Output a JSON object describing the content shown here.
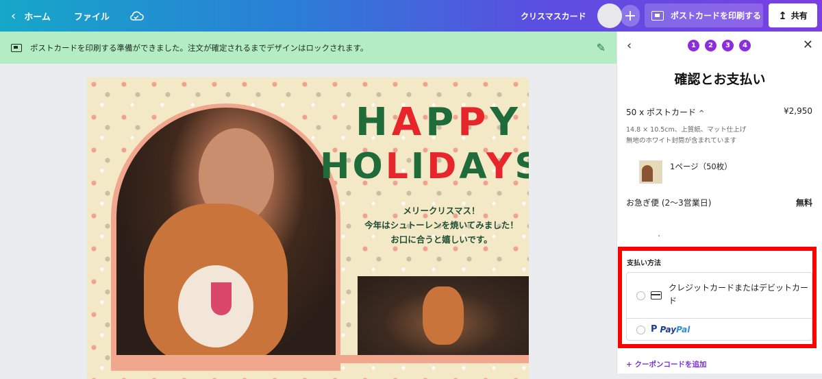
{
  "topbar": {
    "home_chevron": "‹",
    "home_label": "ホーム",
    "file_label": "ファイル",
    "cloud_icon": "cloud-sync-icon",
    "doc_title": "クリスマスカード",
    "plus_label": "+",
    "print_label": "ポストカードを印刷する",
    "share_label": "共有",
    "share_icon": "↥"
  },
  "notice": {
    "text": "ポストカードを印刷する準備ができました。注文が確定されるまでデザインはロックされます。",
    "edit_icon": "✎"
  },
  "card": {
    "happy": [
      "H",
      "A",
      "P",
      "P",
      "Y"
    ],
    "holidays": [
      "H",
      "O",
      "L",
      "I",
      "D",
      "A",
      "Y",
      "S"
    ],
    "greeting_1": "メリークリスマス！",
    "greeting_2": "今年はシュトーレンを焼いてみました！",
    "greeting_3": "お口に合うと嬉しいです。"
  },
  "panel": {
    "back": "‹",
    "steps": [
      "1",
      "2",
      "3",
      "4"
    ],
    "close": "✕",
    "title": "確認とお支払い",
    "item_label": "50 x ポストカード",
    "item_caret": "^",
    "item_price": "¥2,950",
    "spec_1": "14.8 × 10.5cm、上質紙、マット仕上げ",
    "spec_2": "無地のホワイト封筒が含まれています",
    "pages": "1ページ（50枚）",
    "shipping": "お急ぎ便 (2〜3営業日)",
    "shipping_fee": "無料",
    "payment_label": "支払い方法",
    "payment_card": "クレジットカードまたはデビットカード",
    "paypal_pay": "Pay",
    "paypal_pal": "Pal",
    "coupon": "+ クーポンコードを追加"
  },
  "colors": {
    "accent_purple": "#8c2ce0",
    "highlight_red": "#ff0000",
    "notice_green": "#b4ecc4",
    "xmas_green": "#1f6b3a",
    "xmas_red": "#e6262a"
  }
}
